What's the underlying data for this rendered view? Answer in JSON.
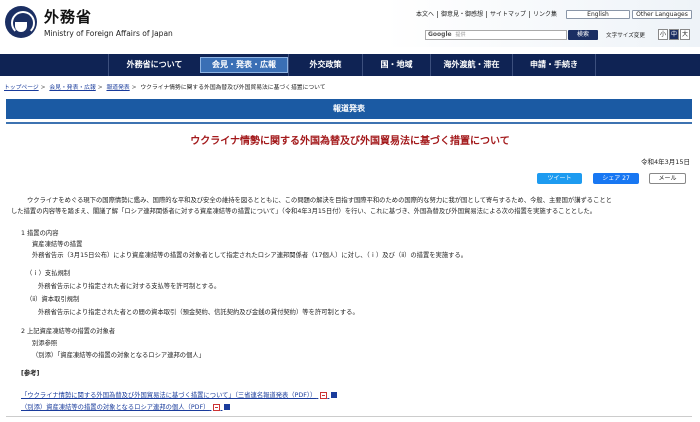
{
  "header": {
    "logo_jp": "外務省",
    "logo_en": "Ministry of Foreign Affairs of Japan",
    "top_links": [
      "本文へ",
      "御意見・御感想",
      "サイトマップ",
      "リンク集"
    ],
    "lang_english": "English",
    "lang_other": "Other Languages",
    "search_label": "Google",
    "search_placeholder": "提供",
    "search_button": "検索",
    "font_size_label": "文字サイズ変更",
    "font_sizes": [
      "小",
      "中",
      "大"
    ]
  },
  "nav": {
    "items": [
      "外務省について",
      "会見・発表・広報",
      "外交政策",
      "国・地域",
      "海外渡航・滞在",
      "申請・手続き"
    ],
    "active_index": 1
  },
  "breadcrumb": {
    "items": [
      "トップページ",
      "会見・発表・広報",
      "報道発表"
    ],
    "current": "ウクライナ情勢に関する外国為替及び外国貿易法に基づく措置について"
  },
  "section": {
    "title": "報道発表"
  },
  "page": {
    "title": "ウクライナ情勢に関する外国為替及び外国貿易法に基づく措置について",
    "date": "令和4年3月15日"
  },
  "share": {
    "twitter": "ツイート",
    "facebook": "シェア 27",
    "mail": "メール"
  },
  "body": {
    "intro_line1": "ウクライナをめぐる現下の国際情勢に鑑み、国際的な平和及び安全の維持を図るとともに、この問題の解決を目指す国際平和のための国際的な努力に我が国として寄与するため、今般、主要国が講ずることと",
    "intro_line2": "した措置の内容等を踏まえ、閣議了解「ロシア連邦関係者に対する資産凍結等の措置について」（令和4年3月15日付）を行い、これに基づき、外国為替及び外国貿易法による次の措置を実施することとした。",
    "s1_heading": "1  措置の内容",
    "s1_sub": "資産凍結等の措置",
    "s1_text": "外務省告示（3月15日公布）により資産凍結等の措置の対象者として指定されたロシア連邦関係者（17個人）に対し、（ｉ）及び（ⅱ）の措置を実施する。",
    "i_heading": "（ｉ）支払規制",
    "i_text": "外務省告示により指定された者に対する支払等を許可制とする。",
    "ii_heading": "（ⅱ）資本取引規制",
    "ii_text": "外務省告示により指定された者との間の資本取引（預金契約、信託契約及び金銭の貸付契約）等を許可制とする。",
    "s2_heading": "2  上記資産凍結等の措置の対象者",
    "s2_sub": "別添参照",
    "s2_text": "（別添）「資産凍結等の措置の対象となるロシア連邦の個人」"
  },
  "refs": {
    "title": "[参考]",
    "links": [
      "「ウクライナ情勢に関する外国為替及び外国貿易法に基づく措置について」（三省連名報道発表（PDF））",
      "（別添）資産凍結等の措置の対象となるロシア連邦の個人（PDF）"
    ]
  }
}
